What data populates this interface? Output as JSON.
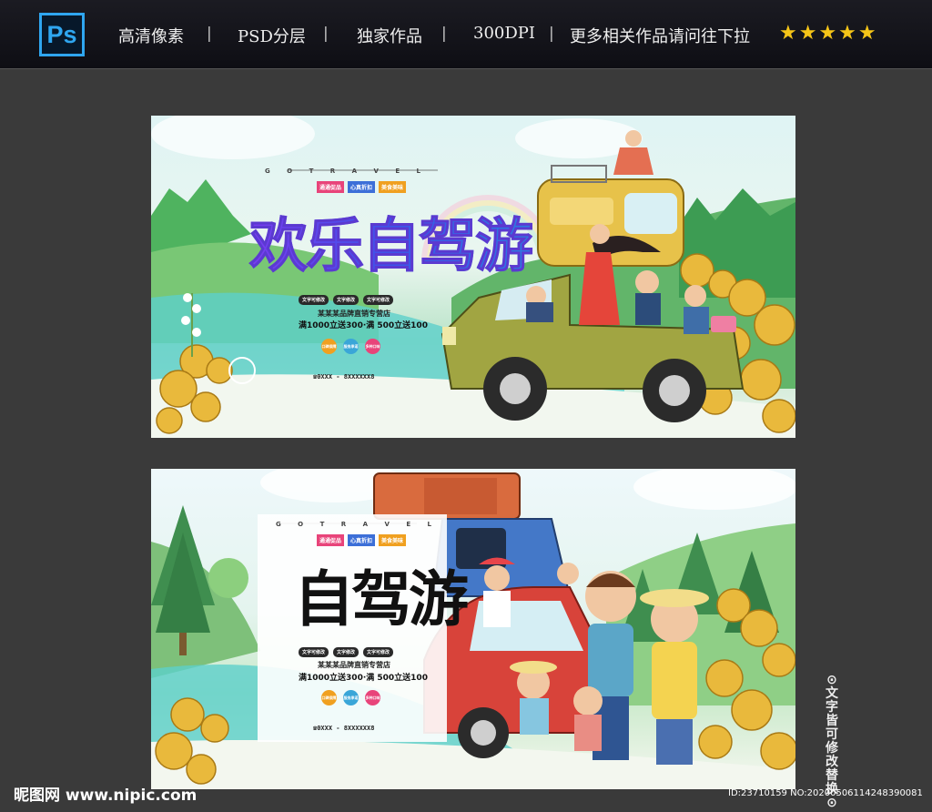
{
  "header": {
    "ps_icon": "Ps",
    "items": [
      "高清像素",
      "PSD分层",
      "独家作品",
      "300DPI",
      "更多相关作品请问往下拉"
    ],
    "separator": "|",
    "stars": "★★★★★",
    "star_color": "#f5c518"
  },
  "banner1": {
    "travel_text": "G O T R A V E L",
    "tags": [
      "通通促品",
      "心真折扣",
      "美食美味"
    ],
    "title": "欢乐自驾游",
    "pills": [
      "文字可修改",
      "文字修改",
      "文字可修改"
    ],
    "store": "某某某品牌直销专营店",
    "offer": "满1000立送300·满 500立送100",
    "circles": [
      "口碑保障",
      "服务承诺",
      "多种口味"
    ],
    "phone": "☎0XXX - 8XXXXXX8"
  },
  "banner2": {
    "travel_text": "G O T R A V E L",
    "tags": [
      "通通促品",
      "心真折扣",
      "美食美味"
    ],
    "title": "自驾游",
    "pills": [
      "文字可修改",
      "文字修改",
      "文字可修改"
    ],
    "store": "某某某品牌直销专营店",
    "offer": "满1000立送300·满 500立送100",
    "circles": [
      "口碑保障",
      "服务承诺",
      "多种口味"
    ],
    "phone": "☎0XXX - 8XXXXXX8"
  },
  "side_note": "⊙文字皆可修改替换⊙",
  "footer": {
    "logo": "昵图网 www.nipic.com",
    "id": "ID:23710159 NO:20200506114248390081"
  }
}
